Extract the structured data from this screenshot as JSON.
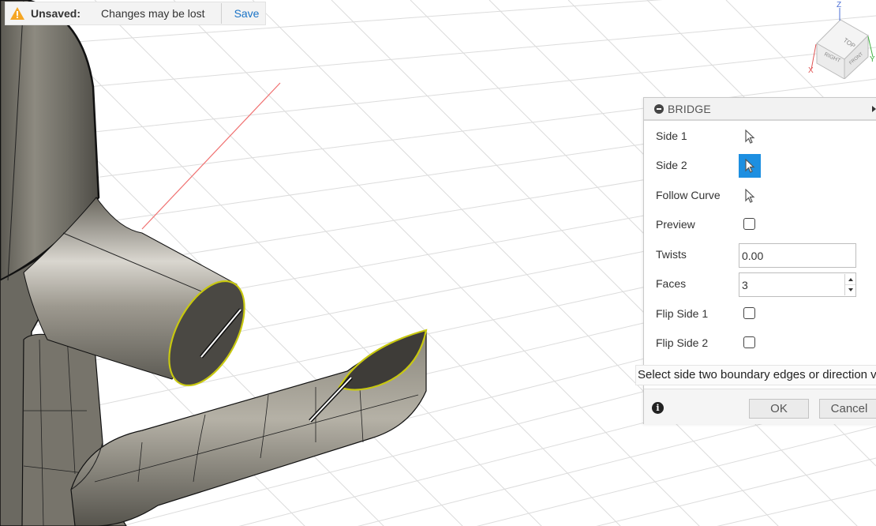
{
  "banner": {
    "status_label": "Unsaved:",
    "message": "Changes may be lost",
    "save_label": "Save",
    "warning_color": "#f5a623",
    "link_color": "#1a73c6"
  },
  "viewcube": {
    "faces": [
      "TOP",
      "RIGHT",
      "FRONT"
    ],
    "axes": [
      "Z",
      "X",
      "Y"
    ]
  },
  "bridge_panel": {
    "title": "BRIDGE",
    "rows": [
      {
        "label": "Side 1",
        "control": "select",
        "active": false
      },
      {
        "label": "Side 2",
        "control": "select",
        "active": true
      },
      {
        "label": "Follow Curve",
        "control": "select",
        "active": false
      },
      {
        "label": "Preview",
        "control": "checkbox",
        "checked": false
      },
      {
        "label": "Twists",
        "control": "text",
        "value": "0.00"
      },
      {
        "label": "Faces",
        "control": "spinner",
        "value": "3"
      },
      {
        "label": "Flip Side 1",
        "control": "checkbox",
        "checked": false
      },
      {
        "label": "Flip Side 2",
        "control": "checkbox",
        "checked": false
      }
    ],
    "tooltip": "Select side two boundary edges or direction v",
    "ok_label": "OK",
    "cancel_label": "Cancel",
    "accent_color": "#1d8fe1"
  }
}
